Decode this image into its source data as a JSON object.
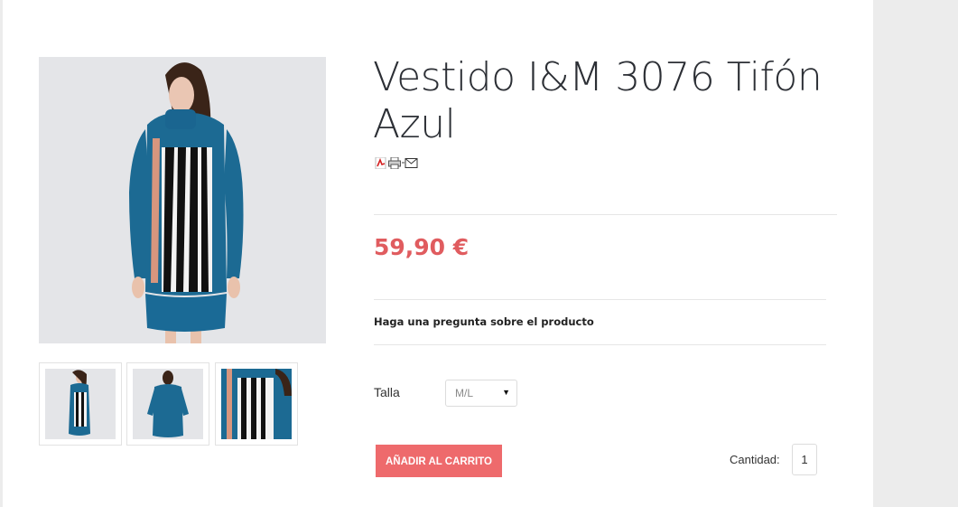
{
  "product": {
    "title": "Vestido I&M 3076 Tifón Azul",
    "price": "59,90 €",
    "ask_question": "Haga una pregunta sobre el producto",
    "icons": [
      "pdf-icon",
      "print-icon",
      "email-icon"
    ]
  },
  "options": {
    "size_label": "Talla",
    "size_value": "M/L"
  },
  "cart": {
    "add_button": "AÑADIR AL CARRITO",
    "quantity_label": "Cantidad:",
    "quantity_value": "1"
  },
  "colors": {
    "price": "#e05c5f",
    "button": "#ee6a6c",
    "dress_blue": "#1c6a93"
  }
}
